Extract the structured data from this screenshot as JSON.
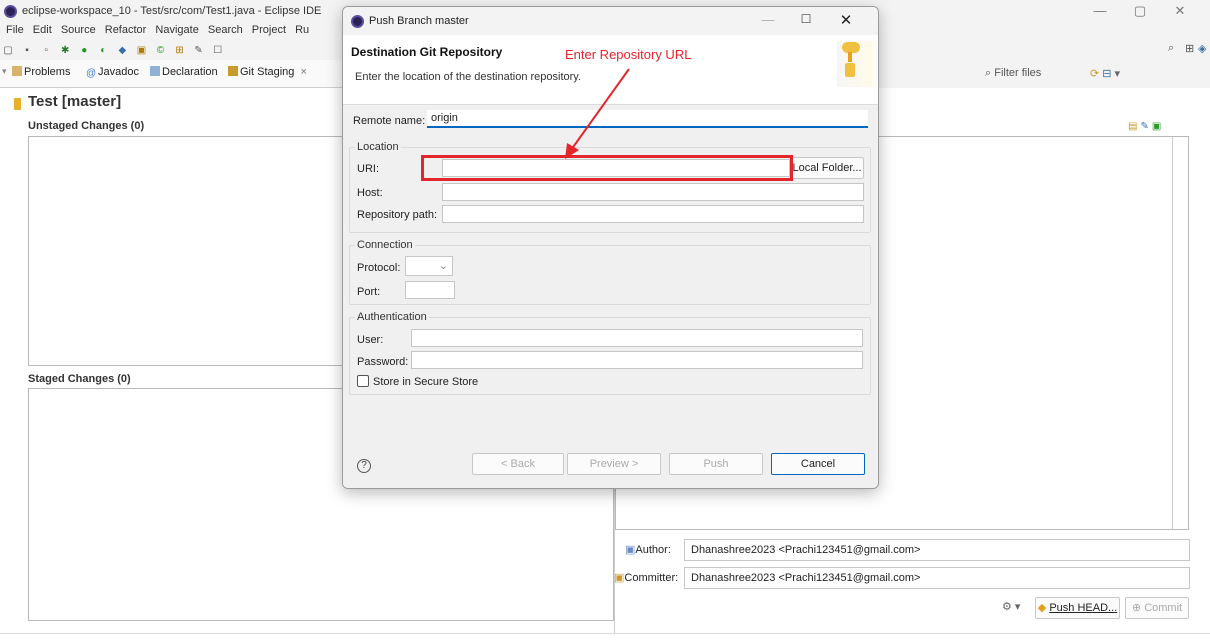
{
  "main": {
    "title": "eclipse-workspace_10 - Test/src/com/Test1.java - Eclipse IDE",
    "menu": [
      "File",
      "Edit",
      "Source",
      "Refactor",
      "Navigate",
      "Search",
      "Project",
      "Ru"
    ],
    "tabs": [
      {
        "label": "Problems",
        "icon": "problems-icon"
      },
      {
        "label": "Javadoc",
        "icon": "javadoc-icon"
      },
      {
        "label": "Declaration",
        "icon": "declaration-icon"
      },
      {
        "label": "Git Staging",
        "icon": "git-staging-icon",
        "close": "×"
      }
    ],
    "repo_title": "Test [master]",
    "unstaged_header": "Unstaged Changes (0)",
    "staged_header": "Staged Changes (0)",
    "filter_placeholder": "Filter files",
    "author_label": "Author:",
    "author_value": "Dhanashree2023 <Prachi123451@gmail.com>",
    "committer_label": "Committer:",
    "committer_value": "Dhanashree2023 <Prachi123451@gmail.com>",
    "push_head_label": "Push HEAD...",
    "commit_label": "Commit"
  },
  "dialog": {
    "title": "Push Branch master",
    "header_title": "Destination Git Repository",
    "header_desc": "Enter the location of the destination repository.",
    "annotation": "Enter Repository URL",
    "remote_name_label": "Remote name:",
    "remote_name_value": "origin",
    "location_group": "Location",
    "uri_label": "URI:",
    "uri_value": "",
    "local_folder_label": "Local Folder...",
    "host_label": "Host:",
    "host_value": "",
    "repo_path_label": "Repository path:",
    "repo_path_value": "",
    "connection_group": "Connection",
    "protocol_label": "Protocol:",
    "protocol_value": "",
    "port_label": "Port:",
    "port_value": "",
    "auth_group": "Authentication",
    "user_label": "User:",
    "user_value": "",
    "password_label": "Password:",
    "password_value": "",
    "secure_store_label": "Store in Secure Store",
    "secure_store_checked": false,
    "back_label": "< Back",
    "preview_label": "Preview >",
    "push_label": "Push",
    "cancel_label": "Cancel"
  },
  "colors": {
    "annotation": "#e3262a",
    "accent": "#0067c0"
  }
}
